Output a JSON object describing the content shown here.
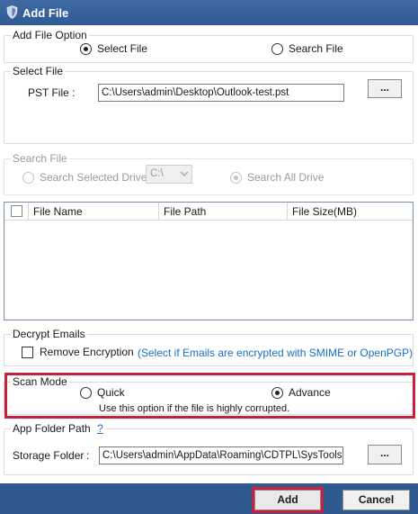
{
  "window": {
    "title": "Add File"
  },
  "add_file_option": {
    "legend": "Add File Option",
    "select_file_label": "Select File",
    "search_file_label": "Search File",
    "selected": "select_file"
  },
  "select_file": {
    "legend": "Select File",
    "pst_label": "PST File :",
    "pst_value": "C:\\Users\\admin\\Desktop\\Outlook-test.pst",
    "browse_label": "..."
  },
  "search_file": {
    "legend": "Search File",
    "selected_drive_label": "Search Selected Drive",
    "drive_value": "C:\\",
    "all_drive_label": "Search All Drive",
    "selected": "search_all_drive",
    "enabled": false
  },
  "file_table": {
    "columns": [
      "File Name",
      "File Path",
      "File Size(MB)"
    ],
    "rows": []
  },
  "decrypt": {
    "legend": "Decrypt Emails",
    "remove_encryption_label": "Remove Encryption",
    "hint": "(Select if Emails are encrypted with SMIME or OpenPGP)",
    "checked": false
  },
  "scan_mode": {
    "legend": "Scan Mode",
    "quick_label": "Quick",
    "advance_label": "Advance",
    "selected": "advance",
    "note": "Use this option if the file is highly corrupted."
  },
  "app_folder": {
    "legend": "App Folder Path",
    "help": "?",
    "storage_label": "Storage Folder",
    "colon": ":",
    "storage_value": "C:\\Users\\admin\\AppData\\Roaming\\CDTPL\\SysTools C",
    "browse_label": "..."
  },
  "footer": {
    "add_label": "Add",
    "cancel_label": "Cancel"
  },
  "colors": {
    "titlebar": "#2f5a94",
    "footer": "#2f5a8f",
    "highlight": "#c8203a",
    "hint": "#1a6fc0"
  }
}
